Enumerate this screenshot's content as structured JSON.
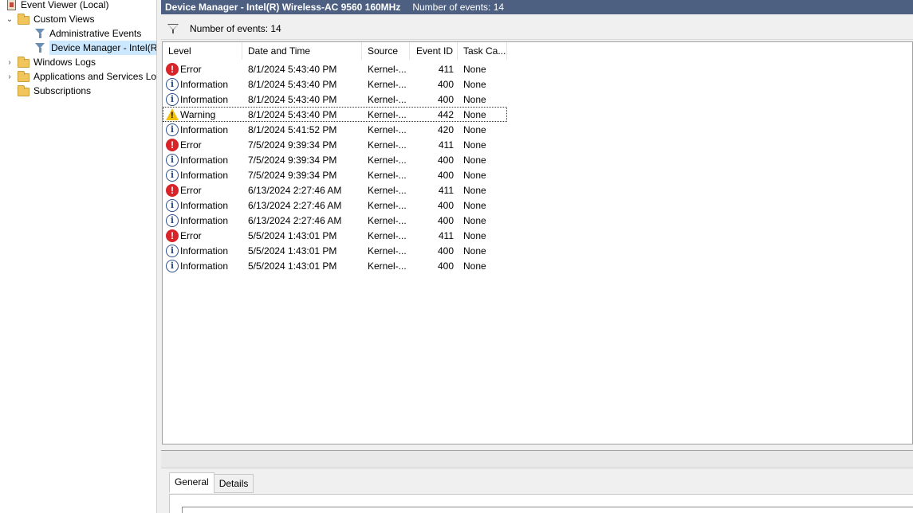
{
  "tree": {
    "items": [
      {
        "label": "Event Viewer (Local)",
        "icon": "event-viewer-icon",
        "expander": ""
      },
      {
        "label": "Custom Views",
        "icon": "folder-icon",
        "expander": "⌄"
      },
      {
        "label": "Administrative Events",
        "icon": "filter-icon",
        "expander": ""
      },
      {
        "label": "Device Manager - Intel(R",
        "icon": "filter-icon",
        "expander": ""
      },
      {
        "label": "Windows Logs",
        "icon": "folder-icon",
        "expander": "›"
      },
      {
        "label": "Applications and Services Lo",
        "icon": "folder-icon",
        "expander": "›"
      },
      {
        "label": "Subscriptions",
        "icon": "folder-icon",
        "expander": ""
      }
    ]
  },
  "header": {
    "title": "Device Manager - Intel(R) Wireless-AC 9560 160MHz",
    "count": "Number of events: 14"
  },
  "filter_bar": {
    "text": "Number of events: 14"
  },
  "table": {
    "columns": [
      "Level",
      "Date and Time",
      "Source",
      "Event ID",
      "Task Ca..."
    ],
    "rows": [
      {
        "level": "Error",
        "icon": "error-icon",
        "date": "8/1/2024 5:43:40 PM",
        "source": "Kernel-...",
        "id": "411",
        "task": "None"
      },
      {
        "level": "Information",
        "icon": "info-icon",
        "date": "8/1/2024 5:43:40 PM",
        "source": "Kernel-...",
        "id": "400",
        "task": "None"
      },
      {
        "level": "Information",
        "icon": "info-icon",
        "date": "8/1/2024 5:43:40 PM",
        "source": "Kernel-...",
        "id": "400",
        "task": "None"
      },
      {
        "level": "Warning",
        "icon": "warning-icon",
        "date": "8/1/2024 5:43:40 PM",
        "source": "Kernel-...",
        "id": "442",
        "task": "None"
      },
      {
        "level": "Information",
        "icon": "info-icon",
        "date": "8/1/2024 5:41:52 PM",
        "source": "Kernel-...",
        "id": "420",
        "task": "None"
      },
      {
        "level": "Error",
        "icon": "error-icon",
        "date": "7/5/2024 9:39:34 PM",
        "source": "Kernel-...",
        "id": "411",
        "task": "None"
      },
      {
        "level": "Information",
        "icon": "info-icon",
        "date": "7/5/2024 9:39:34 PM",
        "source": "Kernel-...",
        "id": "400",
        "task": "None"
      },
      {
        "level": "Information",
        "icon": "info-icon",
        "date": "7/5/2024 9:39:34 PM",
        "source": "Kernel-...",
        "id": "400",
        "task": "None"
      },
      {
        "level": "Error",
        "icon": "error-icon",
        "date": "6/13/2024 2:27:46 AM",
        "source": "Kernel-...",
        "id": "411",
        "task": "None"
      },
      {
        "level": "Information",
        "icon": "info-icon",
        "date": "6/13/2024 2:27:46 AM",
        "source": "Kernel-...",
        "id": "400",
        "task": "None"
      },
      {
        "level": "Information",
        "icon": "info-icon",
        "date": "6/13/2024 2:27:46 AM",
        "source": "Kernel-...",
        "id": "400",
        "task": "None"
      },
      {
        "level": "Error",
        "icon": "error-icon",
        "date": "5/5/2024 1:43:01 PM",
        "source": "Kernel-...",
        "id": "411",
        "task": "None"
      },
      {
        "level": "Information",
        "icon": "info-icon",
        "date": "5/5/2024 1:43:01 PM",
        "source": "Kernel-...",
        "id": "400",
        "task": "None"
      },
      {
        "level": "Information",
        "icon": "info-icon",
        "date": "5/5/2024 1:43:01 PM",
        "source": "Kernel-...",
        "id": "400",
        "task": "None"
      }
    ]
  },
  "details": {
    "tabs": [
      "General",
      "Details"
    ]
  },
  "colors": {
    "title_bar": "#4d6082",
    "selection": "#cce8ff",
    "error": "#d6242a",
    "warning": "#f2c10a",
    "info": "#2b4f8c"
  }
}
